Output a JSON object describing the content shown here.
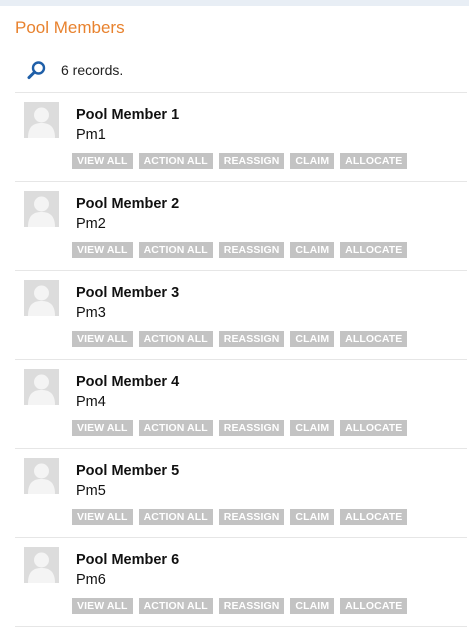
{
  "header": {
    "title": "Pool Members",
    "records_text": "6 records."
  },
  "colors": {
    "title": "#e8822e",
    "button_bg": "#c3c3c3",
    "button_text": "#ffffff",
    "search_icon": "#1f5fa8"
  },
  "icons": {
    "search": "search-icon",
    "avatar": "user-avatar-icon"
  },
  "action_labels": {
    "view_all": "VIEW ALL",
    "action_all": "ACTION ALL",
    "reassign": "REASSIGN",
    "claim": "CLAIM",
    "allocate": "ALLOCATE"
  },
  "members": [
    {
      "name": "Pool Member 1",
      "code": "Pm1"
    },
    {
      "name": "Pool Member 2",
      "code": "Pm2"
    },
    {
      "name": "Pool Member 3",
      "code": "Pm3"
    },
    {
      "name": "Pool Member 4",
      "code": "Pm4"
    },
    {
      "name": "Pool Member 5",
      "code": "Pm5"
    },
    {
      "name": "Pool Member 6",
      "code": "Pm6"
    }
  ]
}
